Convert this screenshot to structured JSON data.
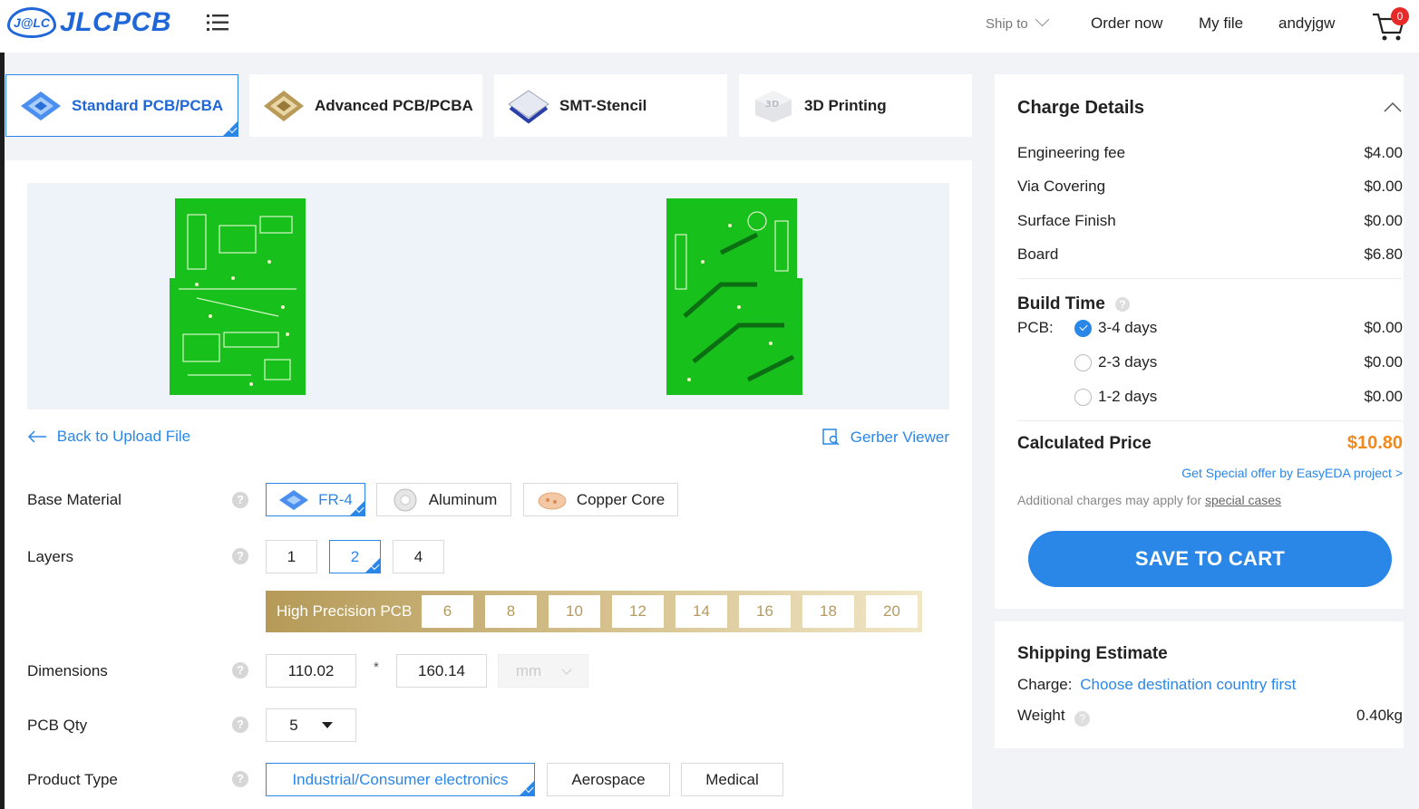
{
  "header": {
    "logo_badge": "J@LC",
    "logo_text": "JLCPCB",
    "ship_to": "Ship to",
    "order_now": "Order now",
    "my_file": "My file",
    "username": "andyjgw",
    "cart_count": "0"
  },
  "product_tabs": [
    {
      "label": "Standard PCB/PCBA",
      "active": true
    },
    {
      "label": "Advanced PCB/PCBA",
      "active": false
    },
    {
      "label": "SMT-Stencil",
      "active": false
    },
    {
      "label": "3D Printing",
      "active": false
    }
  ],
  "links": {
    "back": "Back to Upload File",
    "gerber": "Gerber Viewer"
  },
  "form": {
    "base_material": {
      "label": "Base Material",
      "options": [
        "FR-4",
        "Aluminum",
        "Copper Core"
      ],
      "selected": "FR-4"
    },
    "layers": {
      "label": "Layers",
      "options": [
        "1",
        "2",
        "4"
      ],
      "selected": "2"
    },
    "high_precision": {
      "label": "High Precision PCB",
      "options": [
        "6",
        "8",
        "10",
        "12",
        "14",
        "16",
        "18",
        "20"
      ]
    },
    "dimensions": {
      "label": "Dimensions",
      "width": "110.02",
      "sep": "*",
      "height": "160.14",
      "unit": "mm"
    },
    "qty": {
      "label": "PCB Qty",
      "value": "5"
    },
    "product_type": {
      "label": "Product Type",
      "options": [
        "Industrial/Consumer electronics",
        "Aerospace",
        "Medical"
      ],
      "selected": "Industrial/Consumer electronics"
    },
    "help_glyph": "?"
  },
  "charge": {
    "title": "Charge Details",
    "items": [
      {
        "label": "Engineering fee",
        "value": "$4.00"
      },
      {
        "label": "Via Covering",
        "value": "$0.00"
      },
      {
        "label": "Surface Finish",
        "value": "$0.00"
      },
      {
        "label": "Board",
        "value": "$6.80"
      }
    ],
    "build_time": {
      "title": "Build Time",
      "pcb_label": "PCB:",
      "options": [
        {
          "label": "3-4 days",
          "price": "$0.00",
          "checked": true
        },
        {
          "label": "2-3 days",
          "price": "$0.00",
          "checked": false
        },
        {
          "label": "1-2 days",
          "price": "$0.00",
          "checked": false
        }
      ]
    },
    "calculated_label": "Calculated Price",
    "calculated_value": "$10.80",
    "special_offer": "Get Special offer by EasyEDA project >",
    "note_prefix": "Additional charges may apply for ",
    "note_link": "special cases",
    "save_button": "SAVE TO CART"
  },
  "shipping": {
    "title": "Shipping Estimate",
    "charge_label": "Charge:",
    "charge_link": "Choose destination country first",
    "weight_label": "Weight",
    "weight_value": "0.40kg"
  },
  "colors": {
    "accent": "#2a87e8",
    "price": "#f08a1c",
    "pcb_green": "#17c01a",
    "gold": "#b59a58"
  }
}
